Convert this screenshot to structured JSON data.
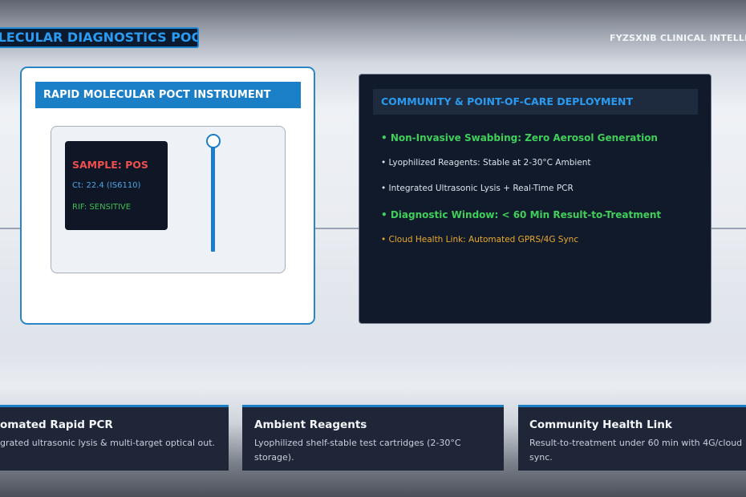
{
  "header": {
    "banner_title": "OLECULAR DIAGNOSTICS POCT",
    "brand": "FYZSXNB CLINICAL INTELLIGE"
  },
  "instrument": {
    "title": "RAPID MOLECULAR POCT INSTRUMENT",
    "screen": {
      "sample": "SAMPLE: POS",
      "ct": "Ct: 22.4 (IS6110)",
      "rif": "RIF: SENSITIVE"
    }
  },
  "deployment": {
    "title": "COMMUNITY & POINT-OF-CARE DEPLOYMENT",
    "items": [
      "• Non-Invasive Swabbing: Zero Aerosol Generation",
      "• Lyophilized Reagents: Stable at 2-30°C Ambient",
      "• Integrated Ultrasonic Lysis + Real-Time PCR",
      "• Diagnostic Window: < 60 Min Result-to-Treatment",
      "• Cloud Health Link: Automated GPRS/4G Sync"
    ]
  },
  "features": [
    {
      "title": "omated Rapid PCR",
      "desc": "grated ultrasonic lysis & multi-target optical out."
    },
    {
      "title": "Ambient Reagents",
      "desc": "Lyophilized shelf-stable test cartridges (2-30°C storage)."
    },
    {
      "title": "Community Health Link",
      "desc": "Result-to-treatment under 60 min with 4G/cloud sync."
    }
  ],
  "colors": {
    "accent": "#1a7fc7",
    "positive": "#ef4f4f",
    "success": "#3fcf5a",
    "warning": "#e9a92b",
    "panel_dark": "#111a2a"
  }
}
